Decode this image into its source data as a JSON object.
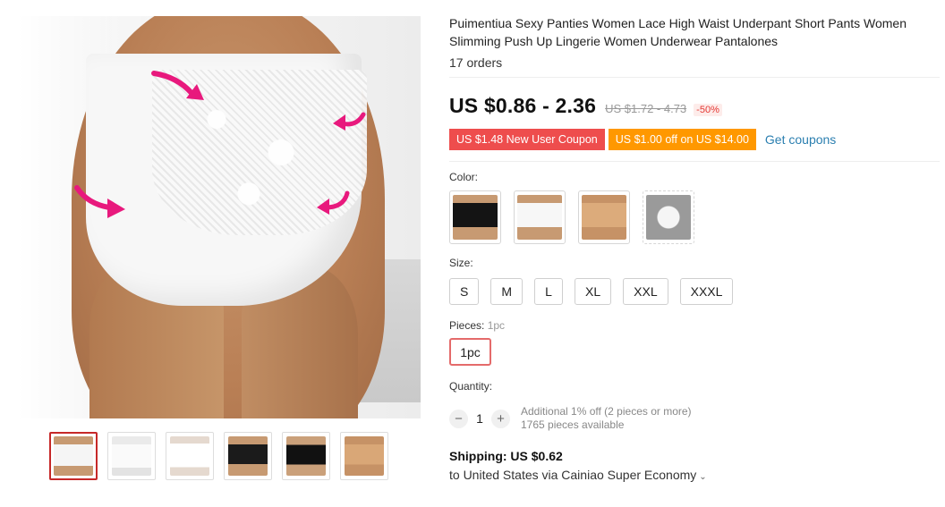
{
  "product": {
    "title": "Puimentiua Sexy Panties Women Lace High Waist Underpant Short Pants Women Slimming Push Up Lingerie Women Underwear Pantalones",
    "orders": "17 orders"
  },
  "price": {
    "current": "US $0.86 - 2.36",
    "original": "US $1.72 - 4.73",
    "discount": "-50%"
  },
  "coupons": {
    "new_user": "US $1.48 New User Coupon",
    "store": "US $1.00 off on US $14.00",
    "get_link": "Get coupons"
  },
  "color": {
    "label": "Color:",
    "swatch_icons": [
      "black-panty-swatch",
      "white-panty-swatch",
      "beige-panty-swatch",
      "packaging-bag-swatch"
    ]
  },
  "size": {
    "label": "Size:",
    "options": [
      "S",
      "M",
      "L",
      "XL",
      "XXL",
      "XXXL"
    ]
  },
  "pieces": {
    "label": "Pieces:",
    "selected": "1pc",
    "option": "1pc"
  },
  "quantity": {
    "label": "Quantity:",
    "minus": "−",
    "value": "1",
    "plus": "+",
    "note_line1": "Additional 1% off (2 pieces or more)",
    "note_line2": "1765 pieces available"
  },
  "shipping": {
    "cost": "Shipping: US $0.62",
    "destination": "to United States via Cainiao Super Economy",
    "chevron": "⌄"
  },
  "gallery": {
    "thumbnail_icons": [
      "white-front-thumb",
      "white-back-thumb",
      "white-side-thumb",
      "black-front-thumb",
      "black-side-thumb",
      "beige-front-thumb"
    ]
  },
  "colors": {
    "accent_red": "#ee4d4d",
    "accent_orange": "#ff9800",
    "link_blue": "#2b7fb0",
    "magenta_arrow": "#e8197d"
  }
}
